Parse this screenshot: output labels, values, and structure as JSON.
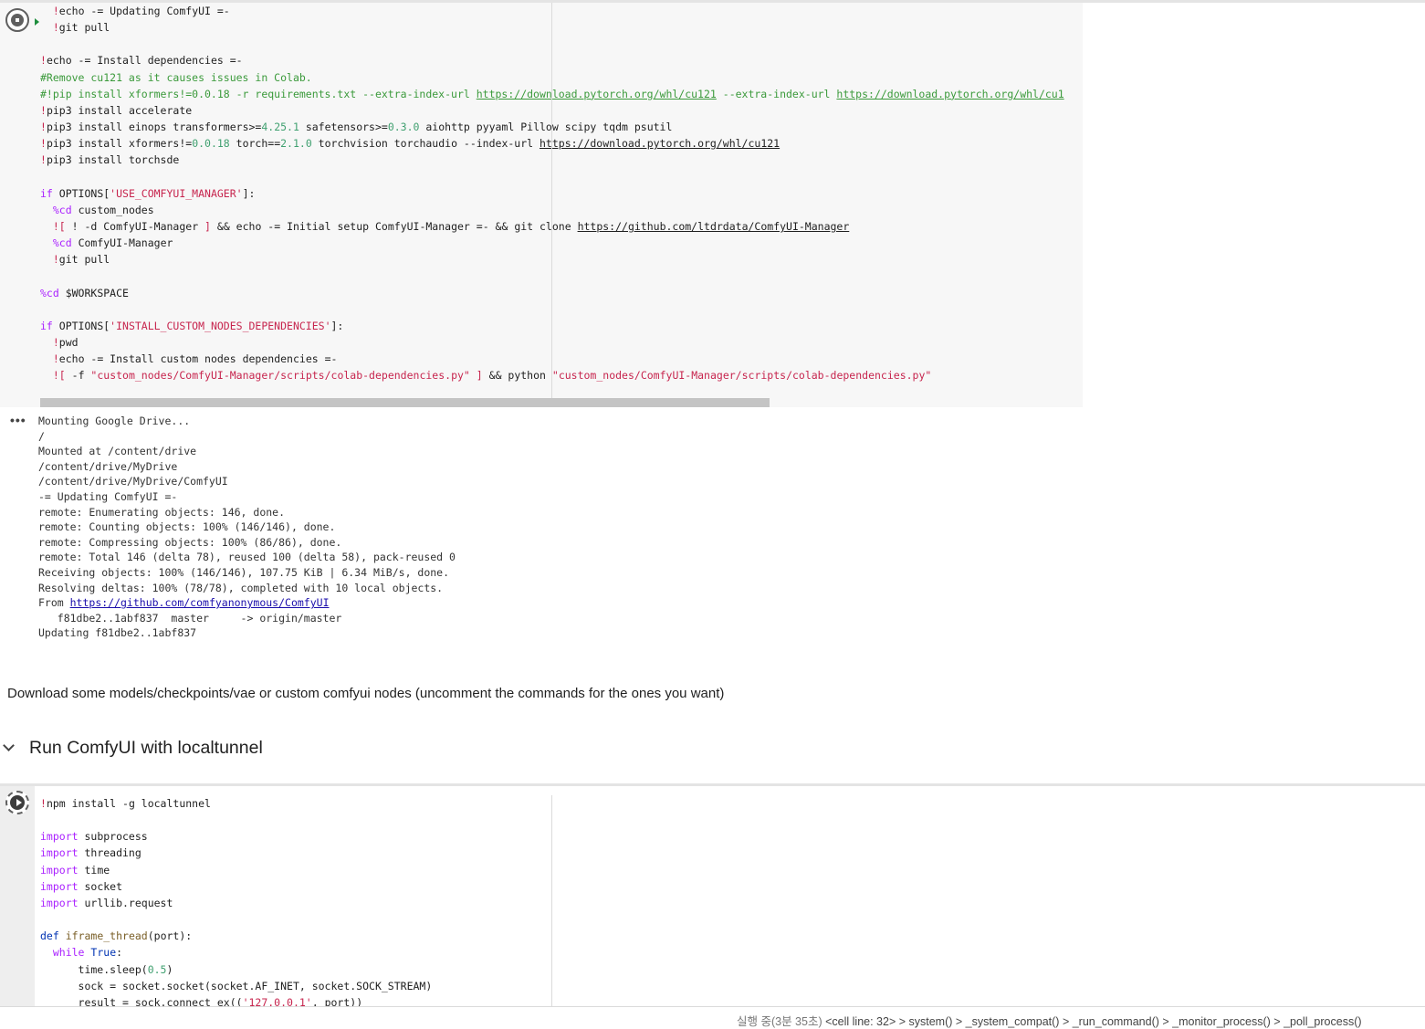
{
  "cell1": {
    "lines": [
      [
        [
          "  ",
          ""
        ],
        [
          "!",
          "str"
        ],
        [
          "echo -= Updating ComfyUI =-",
          ""
        ]
      ],
      [
        [
          "  ",
          ""
        ],
        [
          "!",
          "str"
        ],
        [
          "git pull",
          ""
        ]
      ],
      [
        [
          "",
          ""
        ]
      ],
      [
        [
          "!",
          "str"
        ],
        [
          "echo -= Install dependencies =-",
          ""
        ]
      ],
      [
        [
          "#Remove cu121 as it causes issues in Colab.",
          "cmt"
        ]
      ],
      [
        [
          "#!pip install xformers!=0.0.18 -r requirements.txt --extra-index-url ",
          "cmt"
        ],
        [
          "https://download.pytorch.org/whl/cu121",
          "cmt ul"
        ],
        [
          " --extra-index-url ",
          "cmt"
        ],
        [
          "https://download.pytorch.org/whl/cu1",
          "cmt ul"
        ]
      ],
      [
        [
          "!",
          "str"
        ],
        [
          "pip3 install accelerate",
          ""
        ]
      ],
      [
        [
          "!",
          "str"
        ],
        [
          "pip3 install einops transformers>=",
          ""
        ],
        [
          "4.25.1",
          "num"
        ],
        [
          " safetensors>=",
          ""
        ],
        [
          "0.3.0",
          "num"
        ],
        [
          " aiohttp pyyaml Pillow scipy tqdm psutil",
          ""
        ]
      ],
      [
        [
          "!",
          "str"
        ],
        [
          "pip3 install xformers!=",
          ""
        ],
        [
          "0.0.18",
          "num"
        ],
        [
          " torch==",
          ""
        ],
        [
          "2.1.0",
          "num"
        ],
        [
          " torchvision torchaudio --index-url ",
          ""
        ],
        [
          "https://download.pytorch.org/whl/cu121",
          "ul"
        ]
      ],
      [
        [
          "!",
          "str"
        ],
        [
          "pip3 install torchsde",
          ""
        ]
      ],
      [
        [
          "",
          ""
        ]
      ],
      [
        [
          "if",
          "kw"
        ],
        [
          " OPTIONS[",
          ""
        ],
        [
          "'USE_COMFYUI_MANAGER'",
          "str"
        ],
        [
          "]:",
          ""
        ]
      ],
      [
        [
          "  ",
          ""
        ],
        [
          "%cd",
          "kw"
        ],
        [
          " custom_nodes",
          ""
        ]
      ],
      [
        [
          "  ",
          ""
        ],
        [
          "![",
          "str"
        ],
        [
          " ! -d ComfyUI-Manager ",
          ""
        ],
        [
          "]",
          "str"
        ],
        [
          " && echo -= Initial setup ComfyUI-Manager =- && git clone ",
          ""
        ],
        [
          "https://github.com/ltdrdata/ComfyUI-Manager",
          "ul"
        ]
      ],
      [
        [
          "  ",
          ""
        ],
        [
          "%cd",
          "kw"
        ],
        [
          " ComfyUI-Manager",
          ""
        ]
      ],
      [
        [
          "  ",
          ""
        ],
        [
          "!",
          "str"
        ],
        [
          "git pull",
          ""
        ]
      ],
      [
        [
          "",
          ""
        ]
      ],
      [
        [
          "%cd",
          "kw"
        ],
        [
          " $WORKSPACE",
          ""
        ]
      ],
      [
        [
          "",
          ""
        ]
      ],
      [
        [
          "if",
          "kw"
        ],
        [
          " OPTIONS[",
          ""
        ],
        [
          "'INSTALL_CUSTOM_NODES_DEPENDENCIES'",
          "str"
        ],
        [
          "]:",
          ""
        ]
      ],
      [
        [
          "  ",
          ""
        ],
        [
          "!",
          "str"
        ],
        [
          "pwd",
          ""
        ]
      ],
      [
        [
          "  ",
          ""
        ],
        [
          "!",
          "str"
        ],
        [
          "echo -= Install custom nodes dependencies =-",
          ""
        ]
      ],
      [
        [
          "  ",
          ""
        ],
        [
          "![",
          "str"
        ],
        [
          " -f ",
          ""
        ],
        [
          "\"custom_nodes/ComfyUI-Manager/scripts/colab-dependencies.py\"",
          "str"
        ],
        [
          " ",
          ""
        ],
        [
          "]",
          "str"
        ],
        [
          " && python ",
          ""
        ],
        [
          "\"custom_nodes/ComfyUI-Manager/scripts/colab-dependencies.py\"",
          "str"
        ]
      ]
    ]
  },
  "output": {
    "lines": [
      [
        [
          "Mounting Google Drive...",
          ""
        ]
      ],
      [
        [
          "/",
          ""
        ]
      ],
      [
        [
          "Mounted at /content/drive",
          ""
        ]
      ],
      [
        [
          "/content/drive/MyDrive",
          ""
        ]
      ],
      [
        [
          "/content/drive/MyDrive/ComfyUI",
          ""
        ]
      ],
      [
        [
          "-= Updating ComfyUI =-",
          ""
        ]
      ],
      [
        [
          "remote: Enumerating objects: 146, done.",
          ""
        ]
      ],
      [
        [
          "remote: Counting objects: 100% (146/146), done.",
          ""
        ]
      ],
      [
        [
          "remote: Compressing objects: 100% (86/86), done.",
          ""
        ]
      ],
      [
        [
          "remote: Total 146 (delta 78), reused 100 (delta 58), pack-reused 0",
          ""
        ]
      ],
      [
        [
          "Receiving objects: 100% (146/146), 107.75 KiB | 6.34 MiB/s, done.",
          ""
        ]
      ],
      [
        [
          "Resolving deltas: 100% (78/78), completed with 10 local objects.",
          ""
        ]
      ],
      [
        [
          "From ",
          ""
        ],
        [
          "https://github.com/comfyanonymous/ComfyUI",
          "link"
        ]
      ],
      [
        [
          "   f81dbe2..1abf837  master     -> origin/master",
          ""
        ]
      ],
      [
        [
          "Updating f81dbe2..1abf837",
          ""
        ]
      ]
    ]
  },
  "text_cell": "Download some models/checkpoints/vae or custom comfyui nodes (uncomment the commands for the ones you want)",
  "section_title": "Run ComfyUI with localtunnel",
  "cell2": {
    "lines": [
      [
        [
          "!",
          "str"
        ],
        [
          "npm install -g localtunnel",
          ""
        ]
      ],
      [
        [
          "",
          ""
        ]
      ],
      [
        [
          "import",
          "kw"
        ],
        [
          " subprocess",
          ""
        ]
      ],
      [
        [
          "import",
          "kw"
        ],
        [
          " threading",
          ""
        ]
      ],
      [
        [
          "import",
          "kw"
        ],
        [
          " time",
          ""
        ]
      ],
      [
        [
          "import",
          "kw"
        ],
        [
          " socket",
          ""
        ]
      ],
      [
        [
          "import",
          "kw"
        ],
        [
          " urllib.request",
          ""
        ]
      ],
      [
        [
          "",
          ""
        ]
      ],
      [
        [
          "def",
          "kwb"
        ],
        [
          " ",
          ""
        ],
        [
          "iframe_thread",
          "fn"
        ],
        [
          "(port):",
          ""
        ]
      ],
      [
        [
          "  ",
          ""
        ],
        [
          "while",
          "kw"
        ],
        [
          " ",
          ""
        ],
        [
          "True",
          "kwb"
        ],
        [
          ":",
          ""
        ]
      ],
      [
        [
          "      time.sleep(",
          ""
        ],
        [
          "0.5",
          "num"
        ],
        [
          ")",
          ""
        ]
      ],
      [
        [
          "      sock = socket.socket(socket.AF_INET, socket.SOCK_STREAM)",
          ""
        ]
      ],
      [
        [
          "      result = sock.connect_ex((",
          ""
        ],
        [
          "'127.0.0.1'",
          "str"
        ],
        [
          ", port))",
          ""
        ]
      ]
    ]
  },
  "status": {
    "elapsed": "실행 중(3분 35초)",
    "trace": "<cell line: 32> > system() > _system_compat() > _run_command() > _monitor_process() > _poll_process()"
  },
  "icons": {
    "stop": "stop-cell-icon",
    "run": "run-cell-icon",
    "output_menu": "more-horiz-icon",
    "collapse": "chevron-down-icon"
  },
  "colors": {
    "keyword": "#aa22ff",
    "string": "#c7254e",
    "number": "#40a070",
    "comment": "#3b9a3b",
    "link": "#1a0dab"
  }
}
